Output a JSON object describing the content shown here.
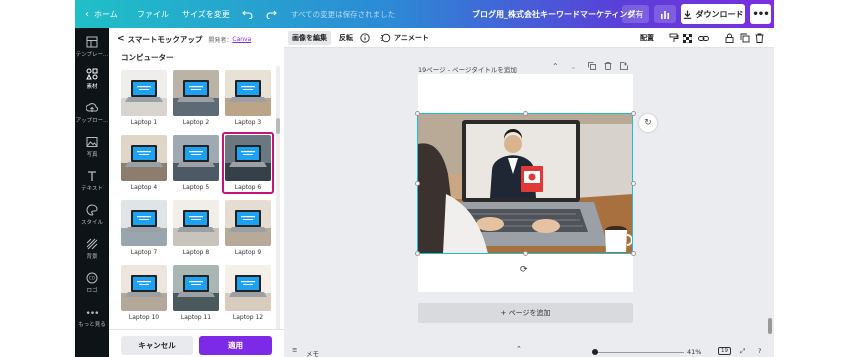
{
  "topbar": {
    "home": "ホーム",
    "file": "ファイル",
    "resize": "サイズを変更",
    "saved": "すべての変更は保存されました",
    "doc_title": "ブログ用_株式会社キーワードマーケティング",
    "share": "共有",
    "download": "ダウンロード",
    "more": "•••"
  },
  "rail": [
    {
      "label": "テンプレー...",
      "icon": "template-icon"
    },
    {
      "label": "素材",
      "icon": "elements-icon"
    },
    {
      "label": "アップロー...",
      "icon": "upload-icon"
    },
    {
      "label": "写真",
      "icon": "photo-icon"
    },
    {
      "label": "テキスト",
      "icon": "text-icon"
    },
    {
      "label": "スタイル",
      "icon": "style-icon"
    },
    {
      "label": "背景",
      "icon": "background-icon"
    },
    {
      "label": "ロゴ",
      "icon": "logo-icon"
    },
    {
      "label": "もっと見る",
      "icon": "more-icon"
    }
  ],
  "panel": {
    "back": "<",
    "title": "スマートモックアップ",
    "developer_label": "開発者：",
    "developer_link": "Canva",
    "category": "コンピューター",
    "thumbnails": [
      "Laptop 1",
      "Laptop 2",
      "Laptop 3",
      "Laptop 4",
      "Laptop 5",
      "Laptop 6",
      "Laptop 7",
      "Laptop 8",
      "Laptop 9",
      "Laptop 10",
      "Laptop 11",
      "Laptop 12"
    ],
    "selected_index": 5,
    "cancel": "キャンセル",
    "apply": "適用"
  },
  "context_toolbar": {
    "edit_image": "画像を編集",
    "flip": "反転",
    "animate": "アニメート",
    "position": "配置"
  },
  "canvas": {
    "page_label": "19ページ - ページタイトルを追加",
    "add_page": "+ ページを追加",
    "memo": "メモ",
    "zoom": "41%",
    "page_count": "19"
  },
  "colors": {
    "accent": "#7d2ae8",
    "selection": "#1fbfc9",
    "highlight": "#c4137b"
  }
}
